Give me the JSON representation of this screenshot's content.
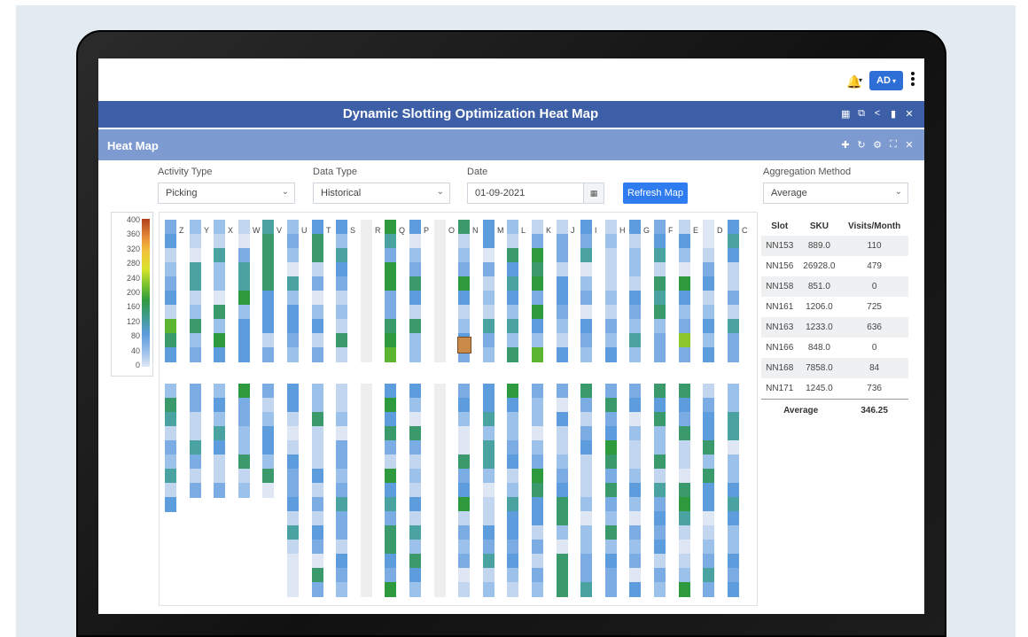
{
  "header": {
    "user_initials": "AD",
    "title": "Dynamic Slotting Optimization Heat Map"
  },
  "panel": {
    "title": "Heat Map"
  },
  "filters": {
    "activity_type": {
      "label": "Activity Type",
      "value": "Picking"
    },
    "data_type": {
      "label": "Data Type",
      "value": "Historical"
    },
    "date": {
      "label": "Date",
      "value": "01-09-2021"
    },
    "refresh_label": "Refresh Map",
    "aggregation": {
      "label": "Aggregation Method",
      "value": "Average"
    }
  },
  "legend": {
    "ticks": [
      "400",
      "360",
      "320",
      "280",
      "240",
      "200",
      "160",
      "120",
      "80",
      "40",
      "0"
    ]
  },
  "heatmap": {
    "aisles": [
      "Z",
      "Y",
      "X",
      "W",
      "V",
      "U",
      "T",
      "S",
      "R",
      "Q",
      "P",
      "O",
      "N",
      "M",
      "L",
      "K",
      "J",
      "I",
      "H",
      "G",
      "F",
      "E",
      "D",
      "C"
    ]
  },
  "slot_table": {
    "headers": [
      "Slot",
      "SKU",
      "Visits/Month"
    ],
    "rows": [
      [
        "NN153",
        "889.0",
        "110"
      ],
      [
        "NN156",
        "26928.0",
        "479"
      ],
      [
        "NN158",
        "851.0",
        "0"
      ],
      [
        "NN161",
        "1206.0",
        "725"
      ],
      [
        "NN163",
        "1233.0",
        "636"
      ],
      [
        "NN166",
        "848.0",
        "0"
      ],
      [
        "NN168",
        "7858.0",
        "84"
      ],
      [
        "NN171",
        "1245.0",
        "736"
      ]
    ],
    "average_label": "Average",
    "average_value": "346.25"
  },
  "colors": {
    "title_bar": "#3c5fa8",
    "panel_bar": "#7d9ad1",
    "accent": "#2f7cf0"
  }
}
